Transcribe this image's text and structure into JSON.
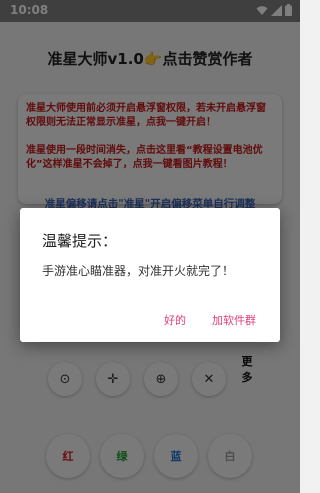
{
  "status_bar": {
    "time": "10:08",
    "icons": [
      "wifi-icon",
      "signal-icon",
      "battery-icon"
    ]
  },
  "app": {
    "title": "准星大师v1.0👉点击赞赏作者",
    "warning_paragraph_1": "准星大师使用前必须开启悬浮窗权限，若未开启悬浮窗权限则无法正常显示准星，点我一键开启！",
    "warning_paragraph_2": "准星使用一段时间消失，点击这里看“教程设置电池优化”这样准星不会掉了，点我一键看图片教程！",
    "blue_tip": "准星偏移请点击\"准星\"开启偏移菜单自行调整",
    "warning_color": "#c21818",
    "tip_color": "#3b63b5",
    "controls": {
      "buttons": [
        "⊙",
        "✛",
        "⊕",
        "✕"
      ],
      "more_label": "更多"
    },
    "color_buttons": [
      {
        "label": "红",
        "color": "#d01c1c"
      },
      {
        "label": "绿",
        "color": "#1f9a2a"
      },
      {
        "label": "蓝",
        "color": "#1f6fd0"
      },
      {
        "label": "白",
        "color": "#9a9a9a"
      }
    ]
  },
  "dialog": {
    "title": "温馨提示：",
    "message": "手游准心瞄准器，对准开火就完了！",
    "positive_button": "好的",
    "neutral_button": "加软件群",
    "button_color": "#e0407a"
  }
}
